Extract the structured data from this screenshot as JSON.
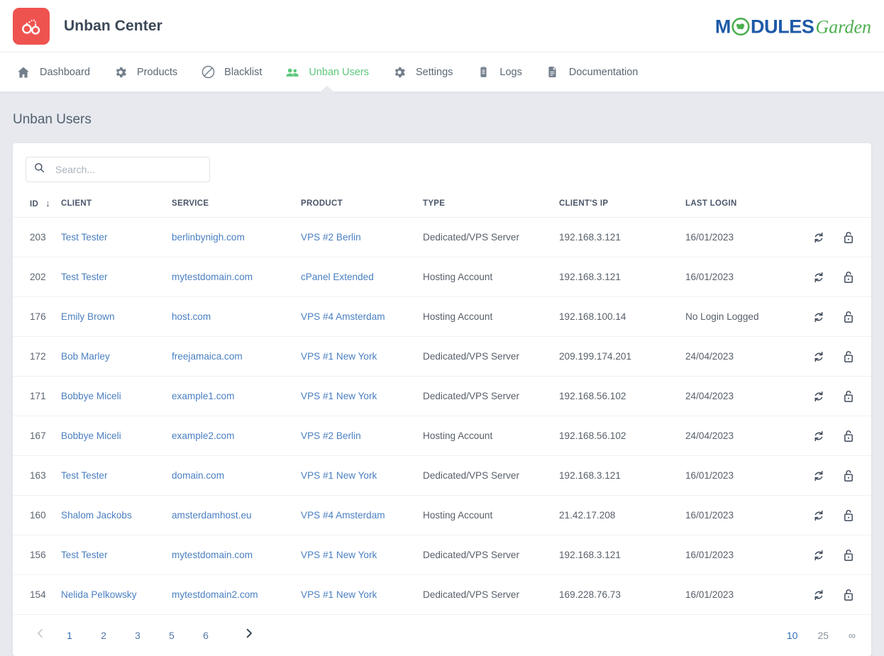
{
  "header": {
    "app_title": "Unban Center",
    "logo_icon": "handcuffs-icon",
    "logo_bg": "#ef5350",
    "vendor_logo": {
      "part1": "M",
      "globe": "globe-icon",
      "part2": "DULES",
      "part3": "Garden",
      "color_dark": "#1e5aa8",
      "color_green": "#4caf50"
    }
  },
  "nav": {
    "active_color": "#5bc87a",
    "items": [
      {
        "label": "Dashboard",
        "icon": "home-icon",
        "active": false
      },
      {
        "label": "Products",
        "icon": "gear-icon",
        "active": false
      },
      {
        "label": "Blacklist",
        "icon": "ban-icon",
        "active": false
      },
      {
        "label": "Unban Users",
        "icon": "users-icon",
        "active": true
      },
      {
        "label": "Settings",
        "icon": "gear-icon",
        "active": false
      },
      {
        "label": "Logs",
        "icon": "clipboard-icon",
        "active": false
      },
      {
        "label": "Documentation",
        "icon": "document-icon",
        "active": false
      }
    ]
  },
  "page": {
    "title": "Unban Users"
  },
  "search": {
    "placeholder": "Search...",
    "value": "",
    "icon": "search-icon"
  },
  "table": {
    "columns": [
      {
        "key": "id",
        "label": "ID",
        "sorted": true,
        "sort_dir": "↓"
      },
      {
        "key": "client",
        "label": "CLIENT"
      },
      {
        "key": "service",
        "label": "SERVICE"
      },
      {
        "key": "product",
        "label": "PRODUCT"
      },
      {
        "key": "type",
        "label": "TYPE"
      },
      {
        "key": "ip",
        "label": "CLIENT'S IP"
      },
      {
        "key": "login",
        "label": "LAST LOGIN"
      }
    ],
    "row_actions": [
      {
        "name": "sync-icon",
        "title": "Sync"
      },
      {
        "name": "unlock-icon",
        "title": "Unban"
      }
    ],
    "rows": [
      {
        "id": "203",
        "client": "Test Tester",
        "service": "berlinbynigh.com",
        "product": "VPS #2 Berlin",
        "type": "Dedicated/VPS Server",
        "ip": "192.168.3.121",
        "login": "16/01/2023"
      },
      {
        "id": "202",
        "client": "Test Tester",
        "service": "mytestdomain.com",
        "product": "cPanel Extended",
        "type": "Hosting Account",
        "ip": "192.168.3.121",
        "login": "16/01/2023"
      },
      {
        "id": "176",
        "client": "Emily Brown",
        "service": "host.com",
        "product": "VPS #4 Amsterdam",
        "type": "Hosting Account",
        "ip": "192.168.100.14",
        "login": "No Login Logged"
      },
      {
        "id": "172",
        "client": "Bob Marley",
        "service": "freejamaica.com",
        "product": "VPS #1 New York",
        "type": "Dedicated/VPS Server",
        "ip": "209.199.174.201",
        "login": "24/04/2023"
      },
      {
        "id": "171",
        "client": "Bobbye Miceli",
        "service": "example1.com",
        "product": "VPS #1 New York",
        "type": "Dedicated/VPS Server",
        "ip": "192.168.56.102",
        "login": "24/04/2023"
      },
      {
        "id": "167",
        "client": "Bobbye Miceli",
        "service": "example2.com",
        "product": "VPS #2 Berlin",
        "type": "Hosting Account",
        "ip": "192.168.56.102",
        "login": "24/04/2023"
      },
      {
        "id": "163",
        "client": "Test Tester",
        "service": "domain.com",
        "product": "VPS #1 New York",
        "type": "Dedicated/VPS Server",
        "ip": "192.168.3.121",
        "login": "16/01/2023"
      },
      {
        "id": "160",
        "client": "Shalom Jackobs",
        "service": "amsterdamhost.eu",
        "product": "VPS #4 Amsterdam",
        "type": "Hosting Account",
        "ip": "21.42.17.208",
        "login": "16/01/2023"
      },
      {
        "id": "156",
        "client": "Test Tester",
        "service": "mytestdomain.com",
        "product": "VPS #1 New York",
        "type": "Dedicated/VPS Server",
        "ip": "192.168.3.121",
        "login": "16/01/2023"
      },
      {
        "id": "154",
        "client": "Nelida Pelkowsky",
        "service": "mytestdomain2.com",
        "product": "VPS #1 New York",
        "type": "Dedicated/VPS Server",
        "ip": "169.228.76.73",
        "login": "16/01/2023"
      }
    ]
  },
  "pagination": {
    "prev_icon": "chevron-left-icon",
    "next_icon": "chevron-right-icon",
    "pages": [
      "1",
      "2",
      "3",
      "5",
      "6"
    ],
    "active_page": "1",
    "per_page_options": [
      "10",
      "25",
      "∞"
    ],
    "per_page_active": "10"
  }
}
